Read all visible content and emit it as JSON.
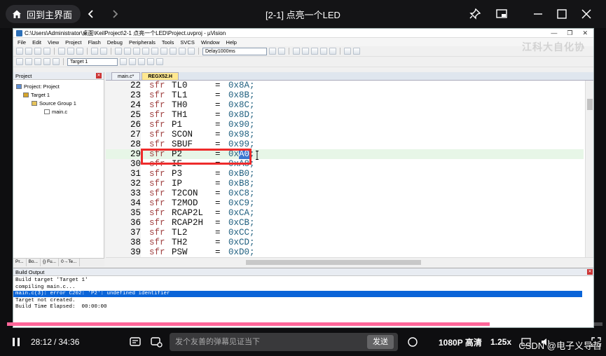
{
  "player": {
    "home_label": "回到主界面",
    "title": "[2-1] 点亮一个LED",
    "time_current": "28:12",
    "time_sep": "/",
    "time_total": "34:36",
    "danmu_placeholder": "发个友善的弹幕见证当下",
    "send_label": "发送",
    "quality": "1080P 高清",
    "speed": "1.25x",
    "progress": 0.81,
    "watermark": "CSDN @电子义导哲",
    "accent_color": "#ff6699"
  },
  "uvision": {
    "window_title": "C:\\Users\\Administrator\\桌面\\KeilProject\\2-1 点亮一个LED\\Project.uvproj - µVision",
    "overlay_watermark": "江科大自化协",
    "menu": [
      "File",
      "Edit",
      "View",
      "Project",
      "Flash",
      "Debug",
      "Peripherals",
      "Tools",
      "SVCS",
      "Window",
      "Help"
    ],
    "target_combo": "Delay1000ms",
    "target_name": "Target 1",
    "project_panel_title": "Project",
    "tree": [
      {
        "label": "Project: Project",
        "level": 0
      },
      {
        "label": "Target 1",
        "level": 1
      },
      {
        "label": "Source Group 1",
        "level": 2
      },
      {
        "label": "main.c",
        "level": 3
      }
    ],
    "panel_tabs": [
      "Pr...",
      "Bo...",
      "{} Fu...",
      "0→Te..."
    ],
    "editor_tabs": [
      "main.c*",
      "REGX52.H"
    ],
    "active_tab_index": 1,
    "code_lines": [
      {
        "ln": "22",
        "kw": "sfr",
        "reg": "TL0",
        "val": "0x8A;"
      },
      {
        "ln": "23",
        "kw": "sfr",
        "reg": "TL1",
        "val": "0x8B;"
      },
      {
        "ln": "24",
        "kw": "sfr",
        "reg": "TH0",
        "val": "0x8C;"
      },
      {
        "ln": "25",
        "kw": "sfr",
        "reg": "TH1",
        "val": "0x8D;"
      },
      {
        "ln": "26",
        "kw": "sfr",
        "reg": "P1",
        "val": "0x90;"
      },
      {
        "ln": "27",
        "kw": "sfr",
        "reg": "SCON",
        "val": "0x98;"
      },
      {
        "ln": "28",
        "kw": "sfr",
        "reg": "SBUF",
        "val": "0x99;"
      },
      {
        "ln": "29",
        "kw": "sfr",
        "reg": "P2",
        "val_pre": "0x",
        "val_sel": "A0",
        "val_post": ";"
      },
      {
        "ln": "30",
        "kw": "sfr",
        "reg": "IE",
        "val": "0xA8;"
      },
      {
        "ln": "31",
        "kw": "sfr",
        "reg": "P3",
        "val": "0xB0;"
      },
      {
        "ln": "32",
        "kw": "sfr",
        "reg": "IP",
        "val": "0xB8;"
      },
      {
        "ln": "33",
        "kw": "sfr",
        "reg": "T2CON",
        "val": "0xC8;"
      },
      {
        "ln": "34",
        "kw": "sfr",
        "reg": "T2MOD",
        "val": "0xC9;"
      },
      {
        "ln": "35",
        "kw": "sfr",
        "reg": "RCAP2L",
        "val": "0xCA;"
      },
      {
        "ln": "36",
        "kw": "sfr",
        "reg": "RCAP2H",
        "val": "0xCB;"
      },
      {
        "ln": "37",
        "kw": "sfr",
        "reg": "TL2",
        "val": "0xCC;"
      },
      {
        "ln": "38",
        "kw": "sfr",
        "reg": "TH2",
        "val": "0xCD;"
      },
      {
        "ln": "39",
        "kw": "sfr",
        "reg": "PSW",
        "val": "0xD0;"
      }
    ],
    "equals": "=",
    "build_output_title": "Build Output",
    "build_lines": [
      {
        "text": "Build target 'Target 1'",
        "error": false
      },
      {
        "text": "compiling main.c...",
        "error": false
      },
      {
        "text": "main.c(3): error C202: 'P2': undefined identifier",
        "error": true
      },
      {
        "text": "Target not created.",
        "error": false
      },
      {
        "text": "Build Time Elapsed:  00:00:00",
        "error": false
      }
    ]
  }
}
